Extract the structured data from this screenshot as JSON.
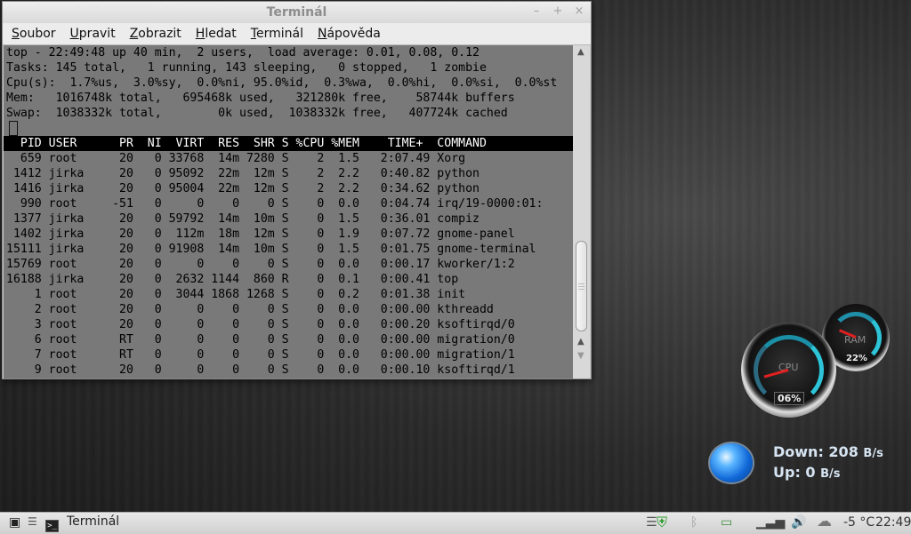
{
  "window": {
    "title": "Terminál",
    "controls": {
      "minimize": "–",
      "maximize": "+",
      "close": "×"
    }
  },
  "menu": [
    "Soubor",
    "Upravit",
    "Zobrazit",
    "Hledat",
    "Terminál",
    "Nápověda"
  ],
  "terminal": {
    "summary": [
      "top - 22:49:48 up 40 min,  2 users,  load average: 0.01, 0.08, 0.12",
      "Tasks: 145 total,   1 running, 143 sleeping,   0 stopped,   1 zombie",
      "Cpu(s):  1.7%us,  3.0%sy,  0.0%ni, 95.0%id,  0.3%wa,  0.0%hi,  0.0%si,  0.0%st",
      "Mem:   1016748k total,   695468k used,   321280k free,    58744k buffers",
      "Swap:  1038332k total,        0k used,  1038332k free,   407724k cached"
    ],
    "header": "  PID USER      PR  NI  VIRT  RES  SHR S %CPU %MEM    TIME+  COMMAND",
    "rows": [
      "  659 root      20   0 33768  14m 7280 S    2  1.5   2:07.49 Xorg",
      " 1412 jirka     20   0 95092  22m  12m S    2  2.2   0:40.82 python",
      " 1416 jirka     20   0 95004  22m  12m S    2  2.2   0:34.62 python",
      "  990 root     -51   0     0    0    0 S    0  0.0   0:04.74 irq/19-0000:01:",
      " 1377 jirka     20   0 59792  14m  10m S    0  1.5   0:36.01 compiz",
      " 1402 jirka     20   0  112m  18m  12m S    0  1.9   0:07.72 gnome-panel",
      "15111 jirka     20   0 91908  14m  10m S    0  1.5   0:01.75 gnome-terminal",
      "15769 root      20   0     0    0    0 S    0  0.0   0:00.17 kworker/1:2",
      "16188 jirka     20   0  2632 1144  860 R    0  0.1   0:00.41 top",
      "    1 root      20   0  3044 1868 1268 S    0  0.2   0:01.38 init",
      "    2 root      20   0     0    0    0 S    0  0.0   0:00.00 kthreadd",
      "    3 root      20   0     0    0    0 S    0  0.0   0:00.20 ksoftirqd/0",
      "    6 root      RT   0     0    0    0 S    0  0.0   0:00.00 migration/0",
      "    7 root      RT   0     0    0    0 S    0  0.0   0:00.00 migration/1",
      "    9 root      20   0     0    0    0 S    0  0.0   0:00.10 ksoftirqd/1"
    ]
  },
  "gauges": {
    "cpu": {
      "label": "CPU",
      "value": "06%",
      "level": 0.06
    },
    "ram": {
      "label": "RAM",
      "value": "22%",
      "level": 0.22
    }
  },
  "network": {
    "down_label": "Down:",
    "down_value": "208",
    "down_unit": "B/s",
    "up_label": "Up:",
    "up_value": "0",
    "up_unit": "B/s"
  },
  "taskbar": {
    "task_label": "Terminál",
    "temperature": "-5 °C",
    "clock": "22:49"
  }
}
